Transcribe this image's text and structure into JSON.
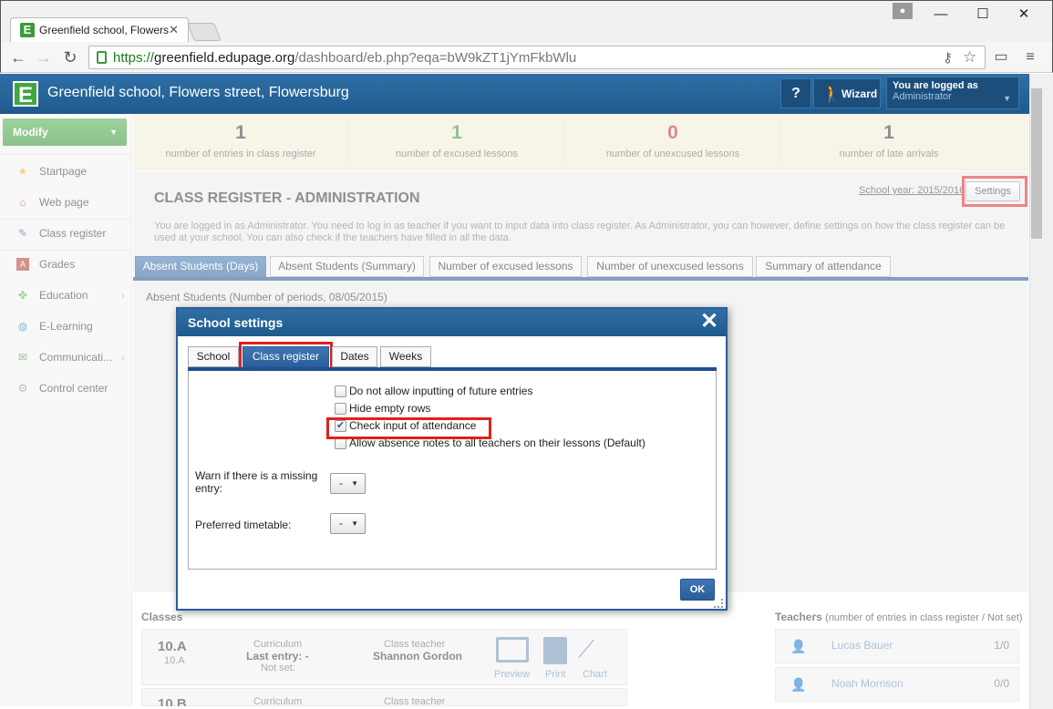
{
  "browser": {
    "tab_title": "Greenfield school, Flowers",
    "favicon_letter": "E",
    "url_scheme": "https://",
    "url_domain": "greenfield.edupage.org",
    "url_path": "/dashboard/eb.php?eqa=bW9kZT1jYmFkbWlu"
  },
  "header": {
    "logo_letter": "E",
    "school_name": "Greenfield school, Flowers street, Flowersburg",
    "help_label": "?",
    "wizard_label": "Wizard",
    "login_line1": "You are logged as",
    "login_line2": "Administrator"
  },
  "sidebar": {
    "modify_label": "Modify",
    "items": [
      {
        "label": "Startpage",
        "icon": "star-icon"
      },
      {
        "label": "Web page",
        "icon": "home-icon"
      },
      {
        "label": "Class register",
        "icon": "pencil-icon"
      },
      {
        "label": "Grades",
        "icon": "grades-book-icon"
      },
      {
        "label": "Education",
        "icon": "puzzle-icon"
      },
      {
        "label": "E-Learning",
        "icon": "globe-icon"
      },
      {
        "label": "Communicati...",
        "icon": "communication-icon"
      },
      {
        "label": "Control center",
        "icon": "gear-icon"
      }
    ]
  },
  "stats": [
    {
      "value": "1",
      "label": "number of entries in class register",
      "color": "#333333"
    },
    {
      "value": "1",
      "label": "number of excused lessons",
      "color": "#3c8a3c"
    },
    {
      "value": "0",
      "label": "number of unexcused lessons",
      "color": "#c0282a"
    },
    {
      "value": "1",
      "label": "number of late arrivals",
      "color": "#333333"
    }
  ],
  "main": {
    "title": "CLASS REGISTER - ADMINISTRATION",
    "school_year": "School year: 2015/2016",
    "settings_label": "Settings",
    "info": "You are logged in as Administrator. You need to log in as teacher if you want to input data into class register. As Administrator, you can however, define settings on how the class register can be used at your school. You can also check if the teachers have filled in all the data.",
    "tabs": [
      "Absent Students (Days)",
      "Absent Students (Summary)",
      "Number of excused lessons",
      "Number of unexcused lessons",
      "Summary of attendance"
    ],
    "absent_title": "Absent Students (Number of periods, 08/05/2015)"
  },
  "classes": {
    "title": "Classes",
    "card": {
      "name": "10.A",
      "sub": "10.A",
      "curriculum_label": "Curriculum",
      "last_entry": "Last entry: -",
      "not_set": "Not set:",
      "teacher_label": "Class teacher",
      "teacher_name": "Shannon Gordon",
      "actions": [
        "Preview",
        "Print",
        "Chart"
      ]
    },
    "card2": {
      "name": "10.B",
      "curriculum_label": "Curriculum",
      "teacher_label": "Class teacher"
    }
  },
  "teachers": {
    "title": "Teachers",
    "subtitle": "(number of entries in class register / Not set)",
    "rows": [
      {
        "name": "Lucas Bauer",
        "count": "1/0"
      },
      {
        "name": "Noah Morrison",
        "count": "0/0"
      }
    ]
  },
  "dialog": {
    "title": "School settings",
    "tabs": [
      "School",
      "Class register",
      "Dates",
      "Weeks"
    ],
    "checkboxes": [
      {
        "label": "Do not allow inputting of future entries",
        "checked": false
      },
      {
        "label": "Hide empty rows",
        "checked": false
      },
      {
        "label": "Check input of attendance",
        "checked": true
      },
      {
        "label": "Allow absence notes to all teachers on their lessons (Default)",
        "checked": false
      }
    ],
    "warn_label_1": "Warn if there is a missing",
    "warn_label_2": "entry:",
    "warn_value": "-",
    "timetable_label": "Preferred timetable:",
    "timetable_value": "-",
    "ok_label": "OK"
  }
}
